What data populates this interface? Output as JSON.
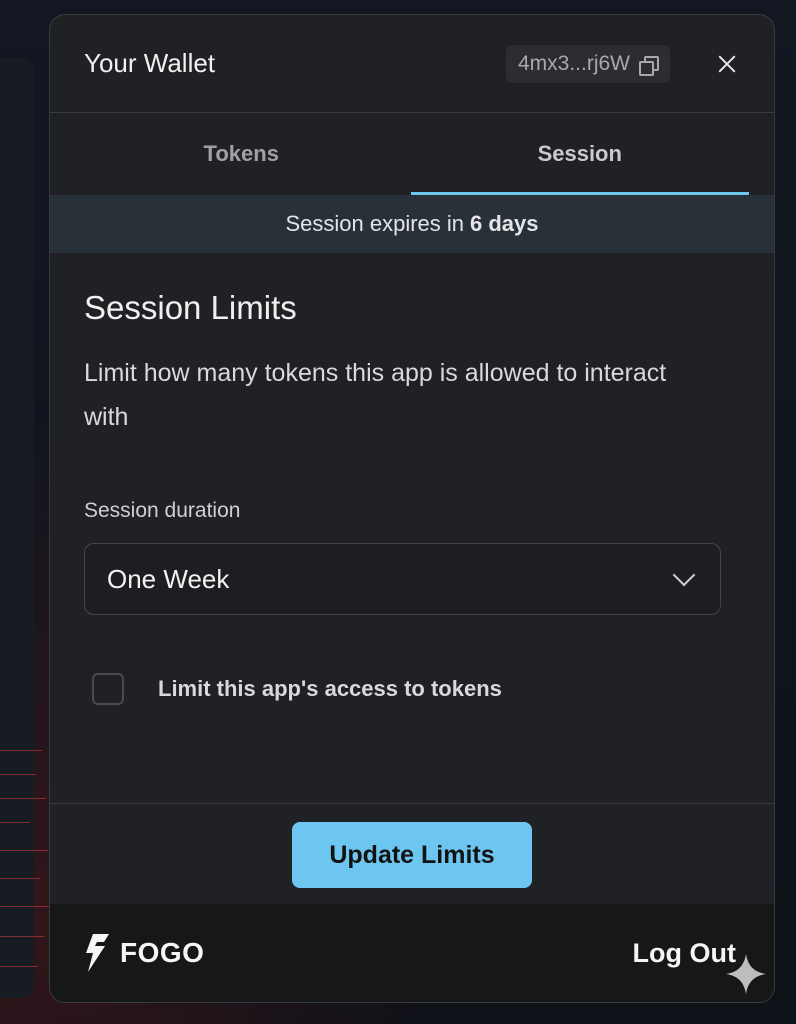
{
  "header": {
    "title": "Your Wallet",
    "address": "4mx3...rj6W"
  },
  "tabs": [
    {
      "label": "Tokens",
      "active": false
    },
    {
      "label": "Session",
      "active": true
    }
  ],
  "session_banner": {
    "prefix": "Session expires in",
    "value": "6 days"
  },
  "session_limits": {
    "title": "Session Limits",
    "description": "Limit how many tokens this app is allowed to interact with",
    "duration_label": "Session duration",
    "duration_value": "One Week",
    "limit_checkbox_label": "Limit this app's access to tokens",
    "limit_checkbox_checked": false
  },
  "actions": {
    "update_label": "Update Limits"
  },
  "footer": {
    "brand": "FOGO",
    "logout_label": "Log Out"
  },
  "colors": {
    "accent": "#6cc6f0",
    "panel": "#202124",
    "banner": "#283038"
  }
}
